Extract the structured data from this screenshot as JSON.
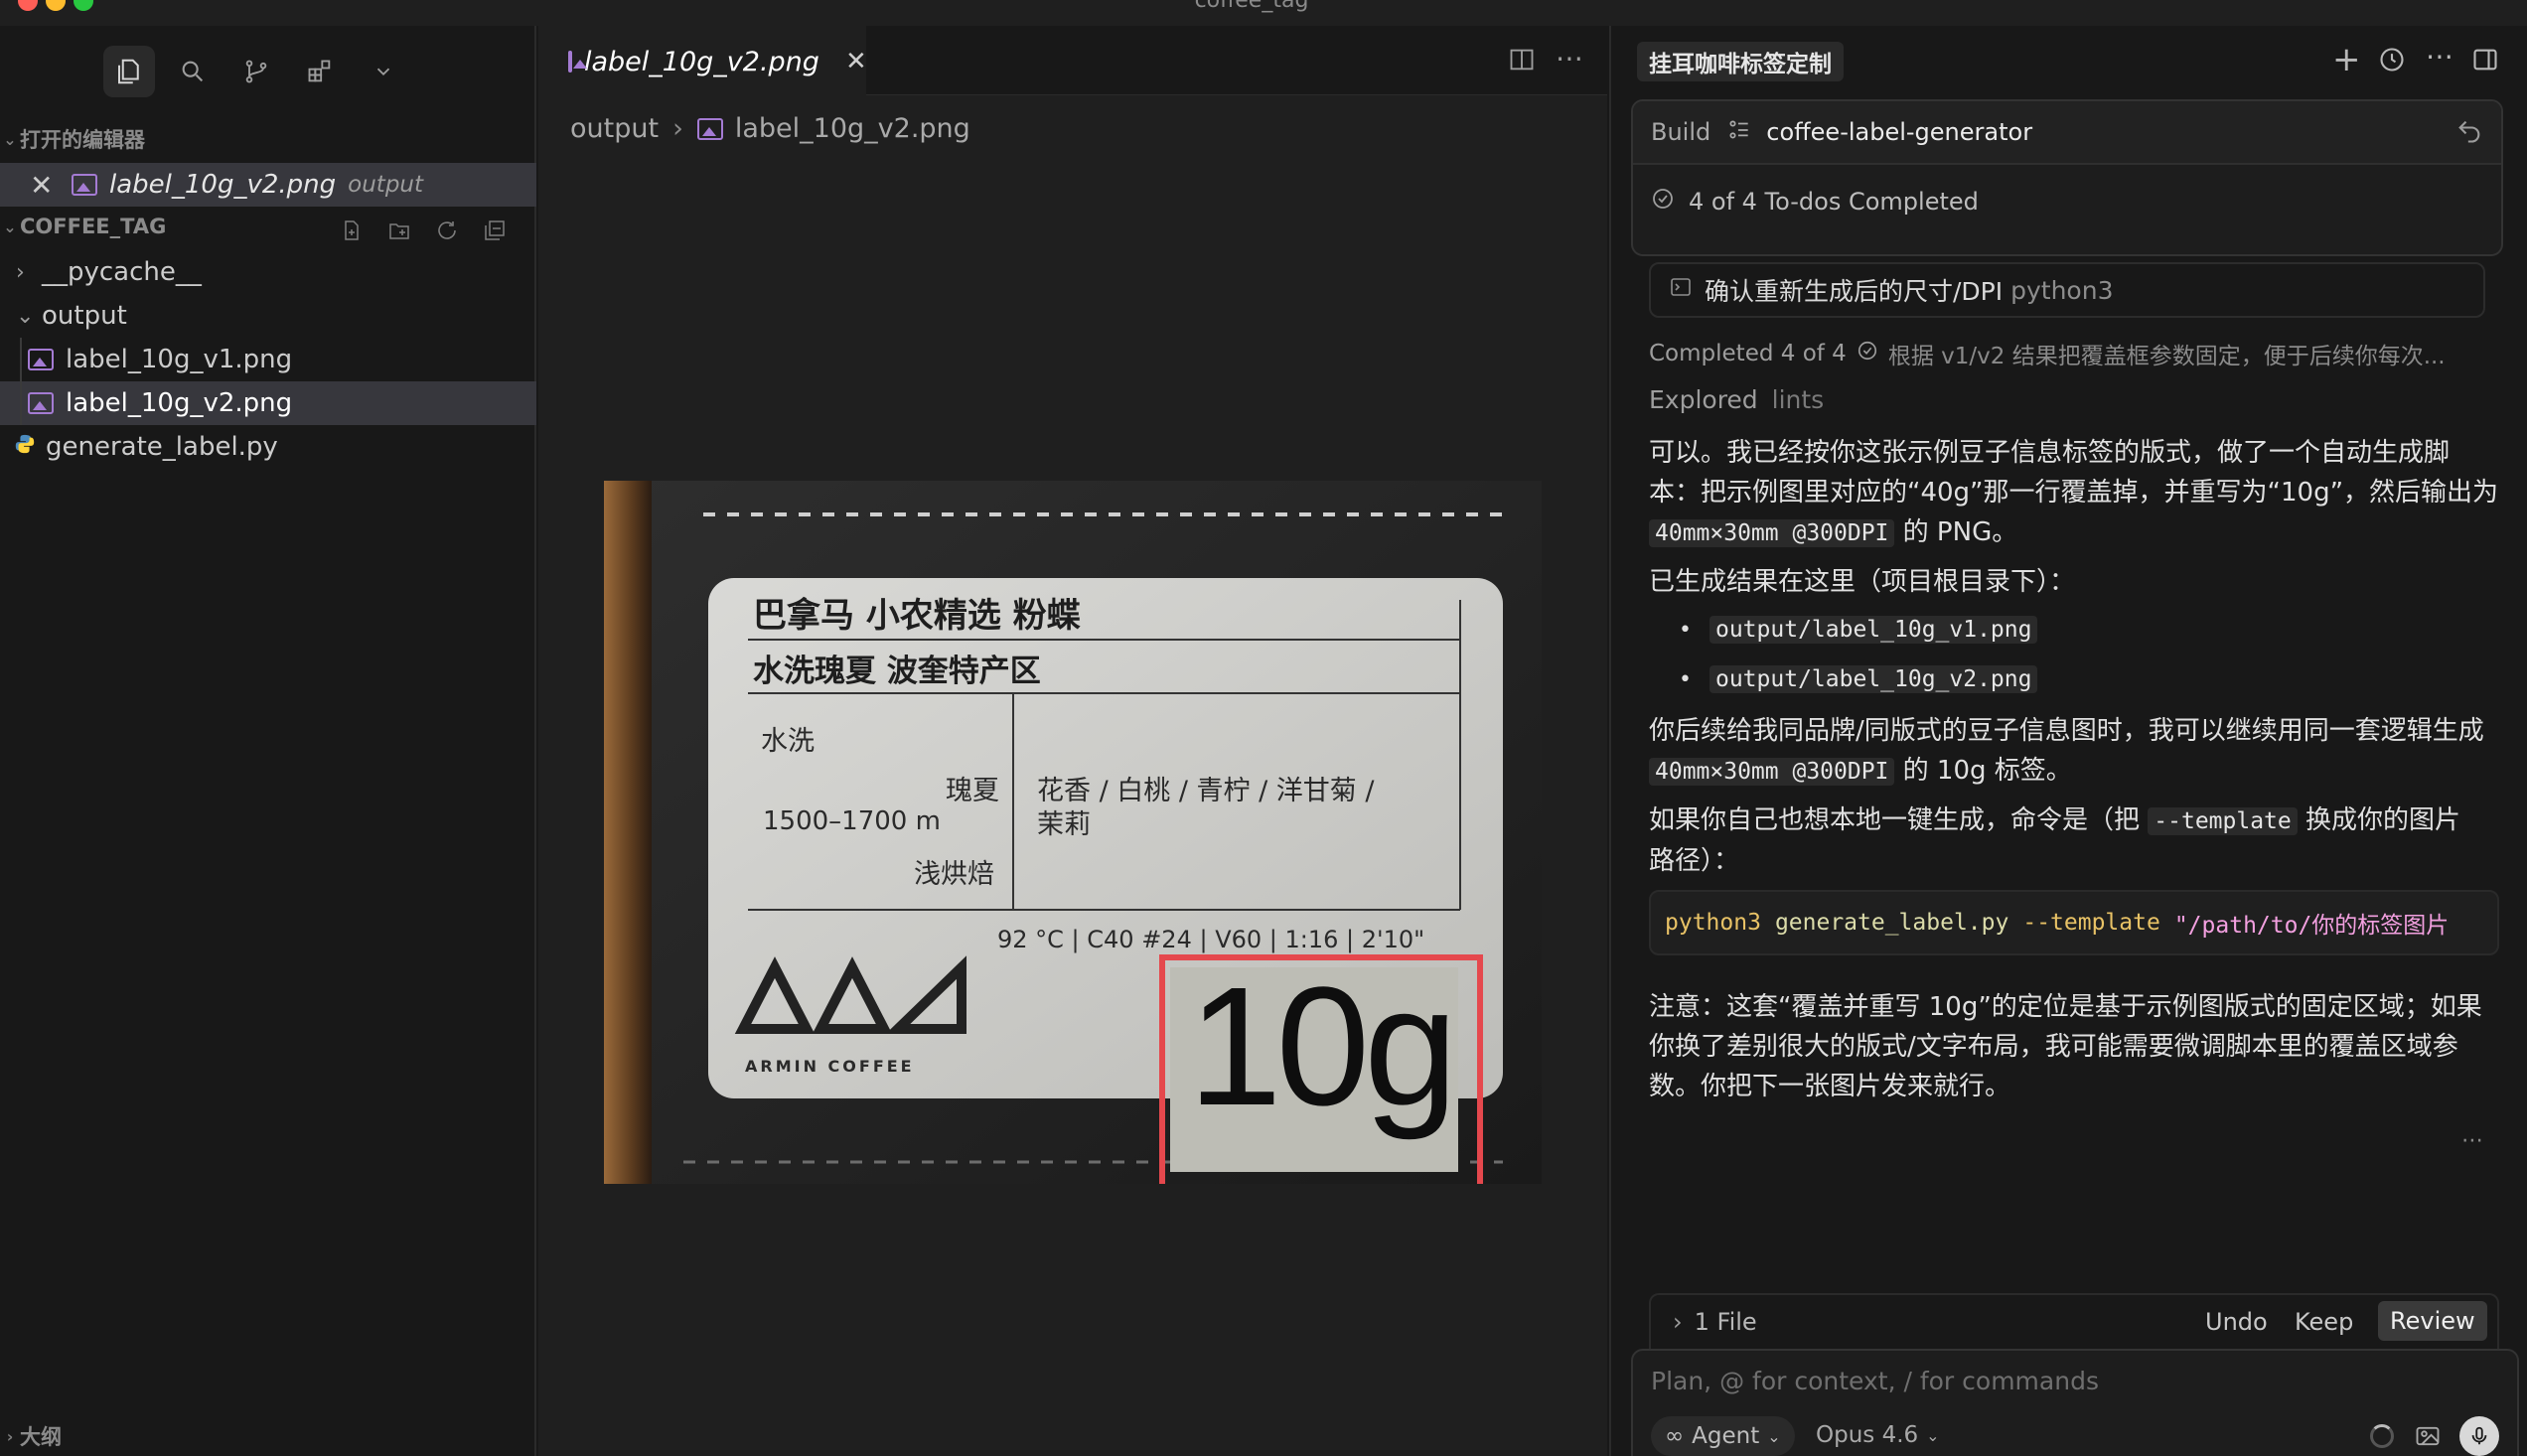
{
  "window": {
    "title": "coffee_tag"
  },
  "sidebar": {
    "open_editors_label": "打开的编辑器",
    "open_editor_file": "label_10g_v2.png",
    "open_editor_folder": "output",
    "project_label": "COFFEE_TAG",
    "tree": {
      "pycache": "__pycache__",
      "output": "output",
      "file_v1": "label_10g_v1.png",
      "file_v2": "label_10g_v2.png",
      "script": "generate_label.py"
    },
    "outline_label": "大纲"
  },
  "editor": {
    "tab_label": "label_10g_v2.png",
    "breadcrumb_folder": "output",
    "breadcrumb_file": "label_10g_v2.png"
  },
  "label_image": {
    "title_line1": "巴拿马 小农精选 粉蝶",
    "title_line2": "水洗瑰夏 波奎特产区",
    "process": "水洗",
    "variety": "瑰夏",
    "altitude": "1500–1700 m",
    "roast": "浅烘焙",
    "flavor_line1": "花香 / 白桃 / 青柠 / 洋甘菊 /",
    "flavor_line2": "茉莉",
    "brew": "92 °C  | C40 #24  | V60  | 1:16  | 2'10\"",
    "brand": "ARMIN  COFFEE",
    "weight": "10g"
  },
  "chat": {
    "panel_title": "挂耳咖啡标签定制",
    "build_label": "Build",
    "build_name": "coffee-label-generator",
    "todos_status": "4 of 4 To-dos Completed",
    "todo_item": "确认重新生成后的尺寸/DPI",
    "todo_item_tag": "python3",
    "completed_prefix": "Completed 4 of 4",
    "completed_text": "根据 v1/v2 结果把覆盖框参数固定，便于后续你每次...",
    "explored_label": "Explored",
    "explored_target": "lints",
    "p1_line1": "可以。我已经按你这张示例豆子信息标签的版式，做了一个自动生成脚",
    "p1_line2": "本：把示例图里对应的“40g”那一行覆盖掉，并重写为“10g”，然后输出为",
    "p1_code": "40mm×30mm @300DPI",
    "p1_end": "的 PNG。",
    "p2": "已生成结果在这里（项目根目录下）：",
    "out_file1": "output/label_10g_v1.png",
    "out_file2": "output/label_10g_v2.png",
    "p3_line1": "你后续给我同品牌/同版式的豆子信息图时，我可以继续用同一套逻辑生成",
    "p3_code": "40mm×30mm @300DPI",
    "p3_end": "的 10g 标签。",
    "p4_start": "如果你自己也想本地一键生成，命令是（把",
    "p4_code": "--template",
    "p4_end": "换成你的图片",
    "p4_line2": "路径）：",
    "cmd_python": "python3",
    "cmd_script": "generate_label.py",
    "cmd_flag": "--template",
    "cmd_path": "\"/path/to/你的标签图片",
    "p5_line1": "注意：这套“覆盖并重写 10g”的定位是基于示例图版式的固定区域；如果",
    "p5_line2": "你换了差别很大的版式/文字布局，我可能需要微调脚本里的覆盖区域参",
    "p5_line3": "数。你把下一张图片发来就行。",
    "files_label": "1 File",
    "undo_label": "Undo",
    "keep_label": "Keep",
    "review_label": "Review",
    "input_placeholder": "Plan, @ for context, / for commands",
    "agent_label": "Agent",
    "model_label": "Opus 4.6"
  },
  "colors": {
    "accent_red_box": "#e5484d",
    "code_yellow": "#dcdcaa",
    "code_string": "#f3a0e0",
    "code_keyword": "#e8c266"
  }
}
